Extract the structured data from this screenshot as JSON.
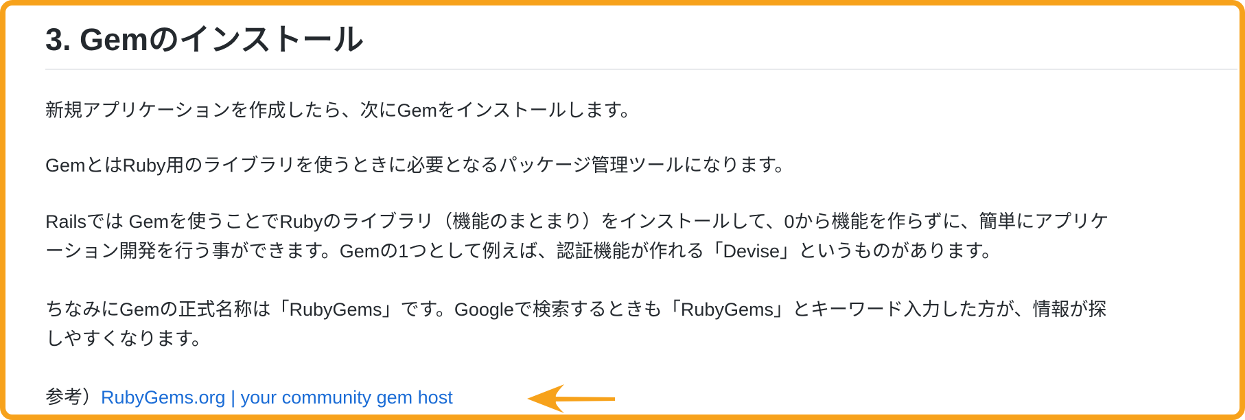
{
  "section": {
    "heading": "3. Gemのインストール"
  },
  "paragraphs": {
    "p1": "新規アプリケーションを作成したら、次にGemをインストールします。",
    "p2": "GemとはRuby用のライブラリを使うときに必要となるパッケージ管理ツールになります。",
    "p3_line1": "Railsでは Gemを使うことでRubyのライブラリ（機能のまとまり）をインストールして、0から機能を作らずに、簡単にアプリケ",
    "p3_line2": "ーション開発を行う事ができます。Gemの1つとして例えば、認証機能が作れる「Devise」というものがあります。",
    "p4_line1": "ちなみにGemの正式名称は「RubyGems」です。Googleで検索するときも「RubyGems」とキーワード入力した方が、情報が探",
    "p4_line2": "しやすくなります。"
  },
  "reference": {
    "prefix": "参考）",
    "link_text": "RubyGems.org | your community gem host"
  },
  "colors": {
    "frame_border": "#f7a21b",
    "arrow": "#f7a21b",
    "link": "#1a6cd6",
    "text": "#24292e",
    "rule": "#e8eaed"
  },
  "icons": {
    "annotation": "arrow-left-icon"
  }
}
